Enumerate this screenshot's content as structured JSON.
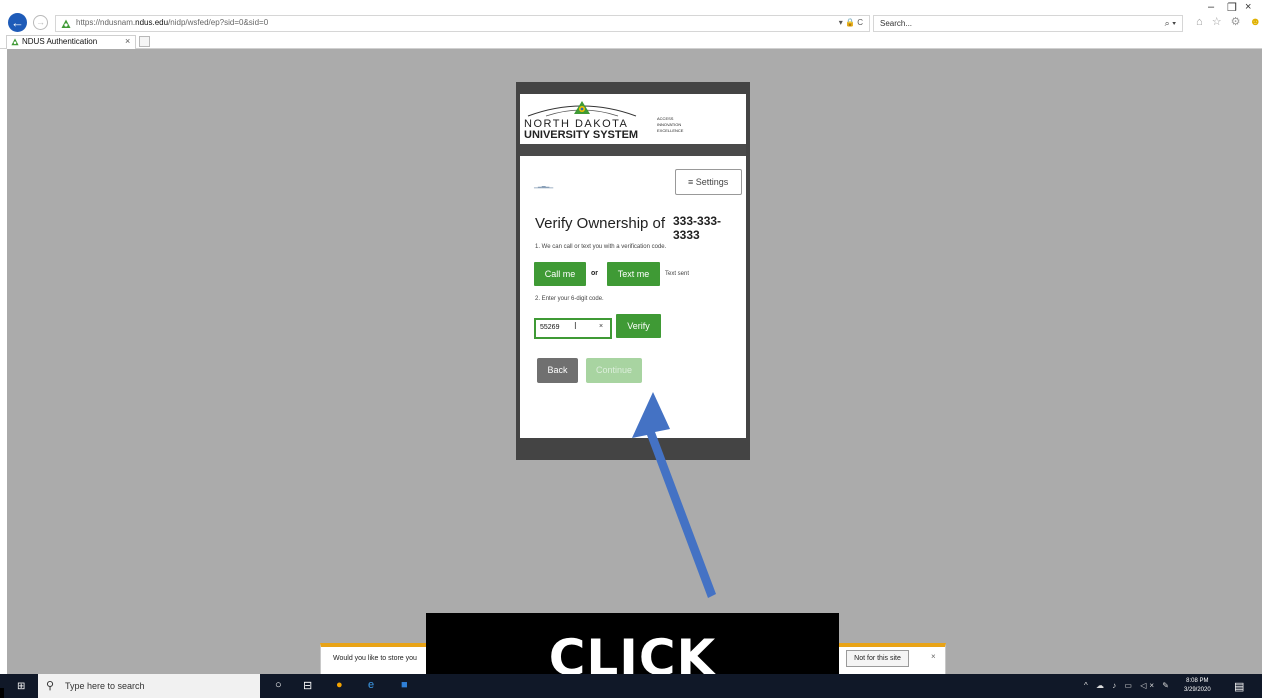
{
  "browser": {
    "url_prefix": "https://ndusnam.",
    "url_domain": "ndus.edu",
    "url_path": "/nidp/wsfed/ep?sid=0&sid=0",
    "search_placeholder": "Search...",
    "tab_title": "NDUS Authentication",
    "tab_close": "×",
    "back_icon": "←",
    "forward_icon": "→",
    "url_tools": "▾ 🔒 C",
    "search_glass": "⌕ ▾",
    "chrome_icons": "⌂ ☆ ⚙",
    "minimize": "–",
    "restore": "❐",
    "close": "×"
  },
  "logo": {
    "line1": "NORTH DAKOTA",
    "line2": "UNIVERSITY SYSTEM",
    "tagline": [
      "ACCESS",
      "INNOVATION",
      "EXCELLENCE"
    ]
  },
  "auth": {
    "settings_label": "≡ Settings",
    "title": "Verify Ownership of",
    "phone": "333-333-3333",
    "step1": "1. We can call or text you with a verification code.",
    "call_label": "Call me",
    "or_label": "or",
    "text_label": "Text me",
    "text_status": "Text sent",
    "step2": "2. Enter your 6-digit code.",
    "code_value": "55269",
    "cursor": "I",
    "clear_label": "×",
    "verify_label": "Verify",
    "back_label": "Back",
    "continue_label": "Continue"
  },
  "notification": {
    "text": "Would you like to store you",
    "not_for_site": "Not for this site",
    "close": "×"
  },
  "caption": "CLICK CONTINUE",
  "taskbar": {
    "search_placeholder": "Type here to search",
    "time": "8:08 PM",
    "date": "3/29/2020",
    "tray": "^ ☁ ♪ ▭ ◁× ✎"
  },
  "colors": {
    "accent_green": "#3f9a35",
    "continue_disabled": "#a8d4a1",
    "arrow_blue": "#4472c4",
    "warning_bar": "#e8a317"
  }
}
